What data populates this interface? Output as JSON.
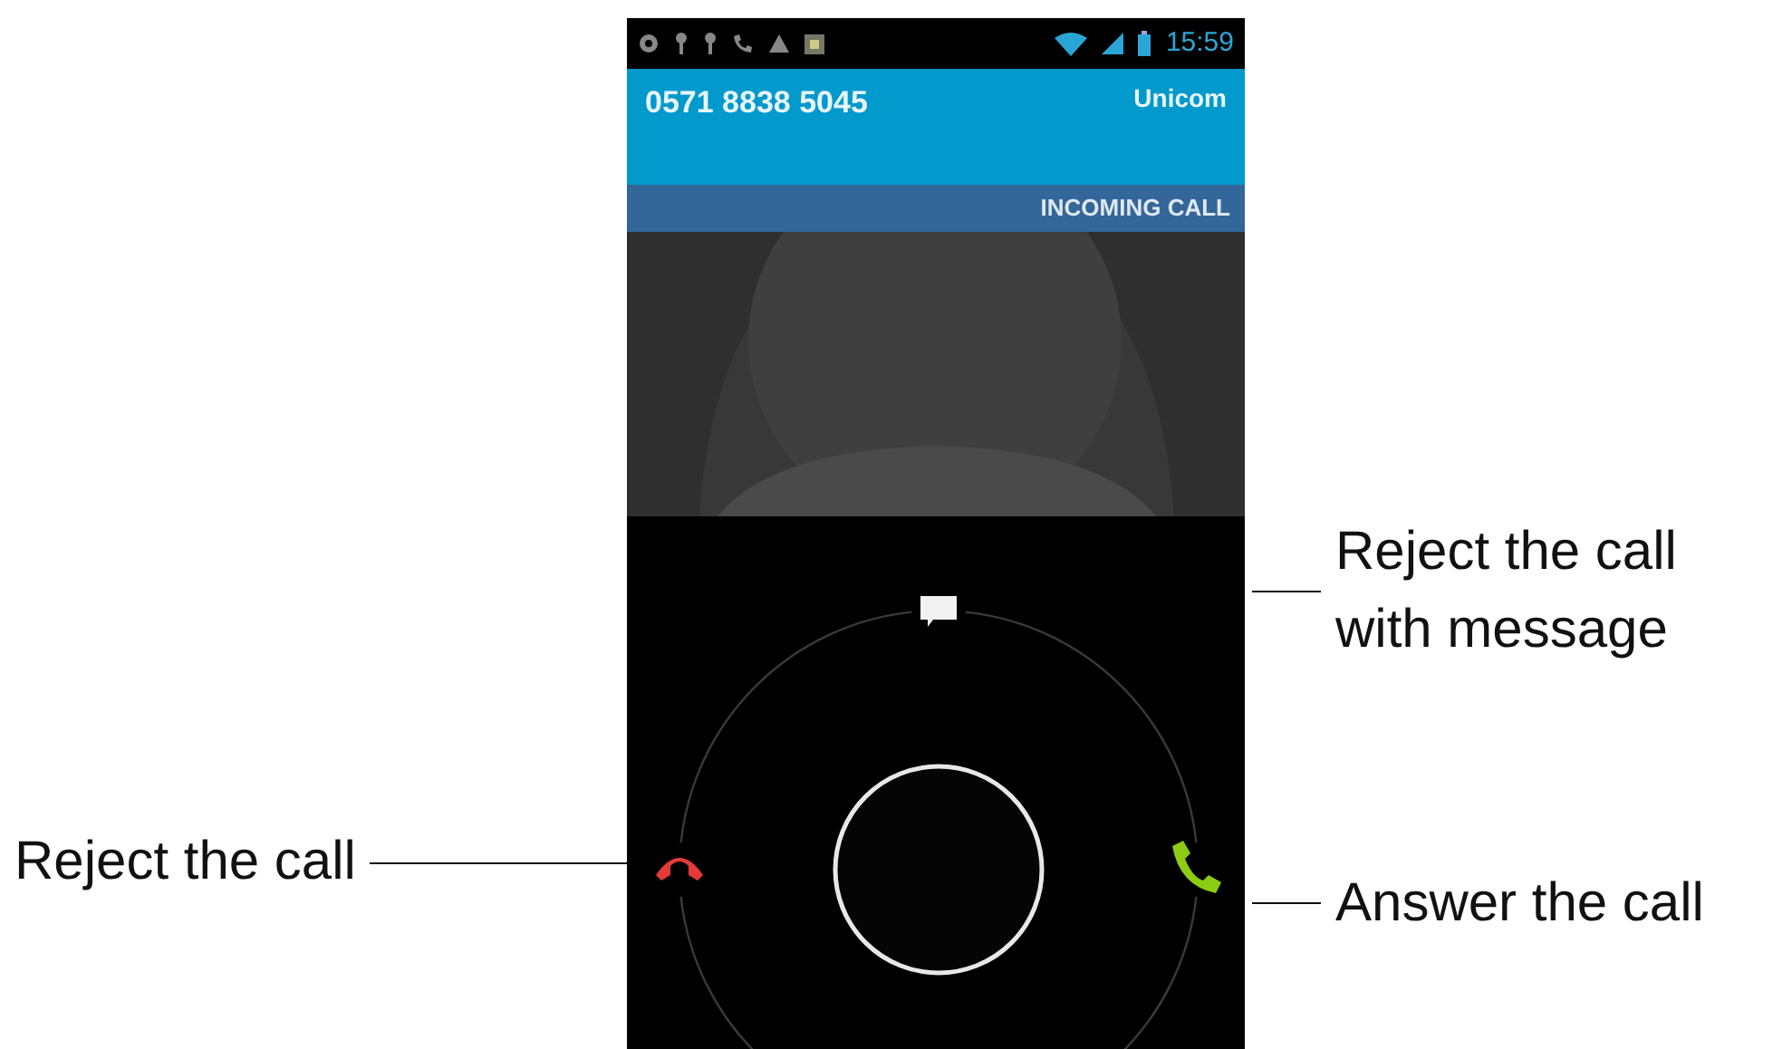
{
  "status_bar": {
    "time": "15:59"
  },
  "caller": {
    "number": "0571 8838 5045",
    "carrier": "Unicom"
  },
  "call_state": "INCOMING CALL",
  "slider_targets": [
    {
      "kind": "message"
    },
    {
      "kind": "reject"
    },
    {
      "kind": "answer"
    }
  ],
  "annotations": {
    "left": [
      {
        "text": "Reject the call"
      }
    ],
    "right": [
      {
        "text": "Reject the call with message"
      },
      {
        "text": "Answer the call"
      }
    ]
  }
}
